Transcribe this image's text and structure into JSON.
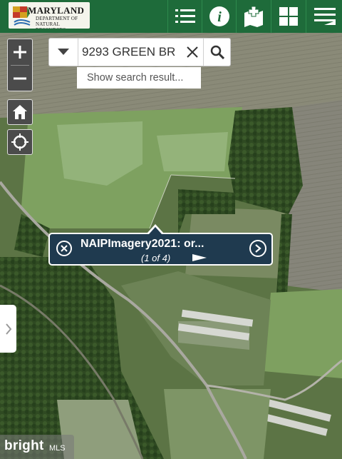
{
  "header": {
    "logo": {
      "line1": "MARYLAND",
      "line2": "DEPARTMENT OF",
      "line3": "NATURAL RESOURCES"
    },
    "buttons": [
      {
        "name": "layers-list-button",
        "icon": "list-icon"
      },
      {
        "name": "info-button",
        "icon": "info-icon"
      },
      {
        "name": "add-map-button",
        "icon": "map-plus-icon"
      },
      {
        "name": "basemap-gallery-button",
        "icon": "grid-icon"
      },
      {
        "name": "legend-button",
        "icon": "legend-lines-icon"
      }
    ]
  },
  "controls": {
    "zoom_in_icon": "plus-icon",
    "zoom_out_icon": "minus-icon",
    "home_icon": "home-icon",
    "locate_icon": "crosshair-icon"
  },
  "search": {
    "value": "9293 GREEN BR",
    "hint": "Show search result..."
  },
  "popup": {
    "title": "NAIPImagery2021: or...",
    "count": "(1 of 4)"
  },
  "watermark": {
    "brand": "bright",
    "suffix": "MLS"
  },
  "colors": {
    "header": "#1e6b3a",
    "popup": "#1f3a4f",
    "control": "#4b4b4b"
  }
}
